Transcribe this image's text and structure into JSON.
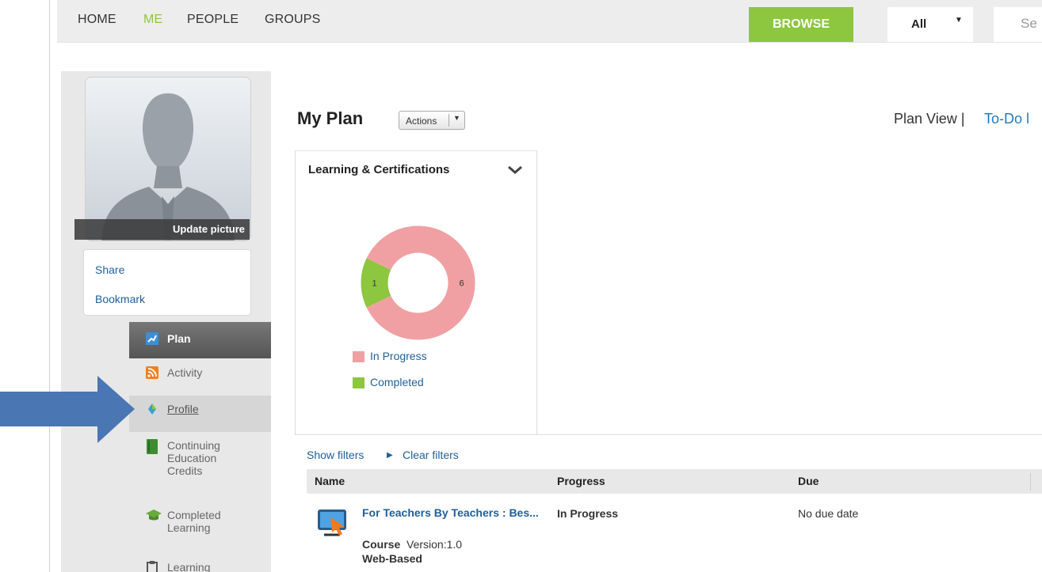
{
  "nav": {
    "home": "HOME",
    "me": "ME",
    "people": "PEOPLE",
    "groups": "GROUPS",
    "browse": "BROWSE",
    "filter_value": "All",
    "search_placeholder": "Se"
  },
  "sidebar": {
    "update_picture": "Update picture",
    "share": "Share",
    "bookmark": "Bookmark",
    "items": [
      {
        "label": "Plan",
        "icon": "plan-icon"
      },
      {
        "label": "Activity",
        "icon": "rss-icon"
      },
      {
        "label": "Profile",
        "icon": "profile-icon"
      },
      {
        "label": "Continuing Education Credits",
        "icon": "book-icon"
      },
      {
        "label": "Completed Learning",
        "icon": "graduation-cap-icon"
      },
      {
        "label": "Learning",
        "icon": "clipboard-icon"
      }
    ]
  },
  "main": {
    "title": "My Plan",
    "actions_label": "Actions",
    "plan_view": "Plan View",
    "separator": "|",
    "todo": "To-Do l",
    "widget": {
      "title": "Learning & Certifications"
    },
    "show_filters": "Show filters",
    "clear_filters": "Clear filters",
    "table": {
      "columns": [
        "Name",
        "Progress",
        "Due"
      ],
      "rows": [
        {
          "title": "For Teachers By Teachers : Bes...",
          "type_label": "Course",
          "version": "Version:1.0",
          "delivery": "Web-Based",
          "progress": "In Progress",
          "due": "No due date"
        }
      ]
    }
  },
  "chart_data": {
    "type": "pie",
    "title": "",
    "categories": [
      "In Progress",
      "Completed"
    ],
    "values": [
      6,
      1
    ],
    "colors": [
      "#f0a0a3",
      "#8dc63f"
    ],
    "legend": "bottom"
  }
}
